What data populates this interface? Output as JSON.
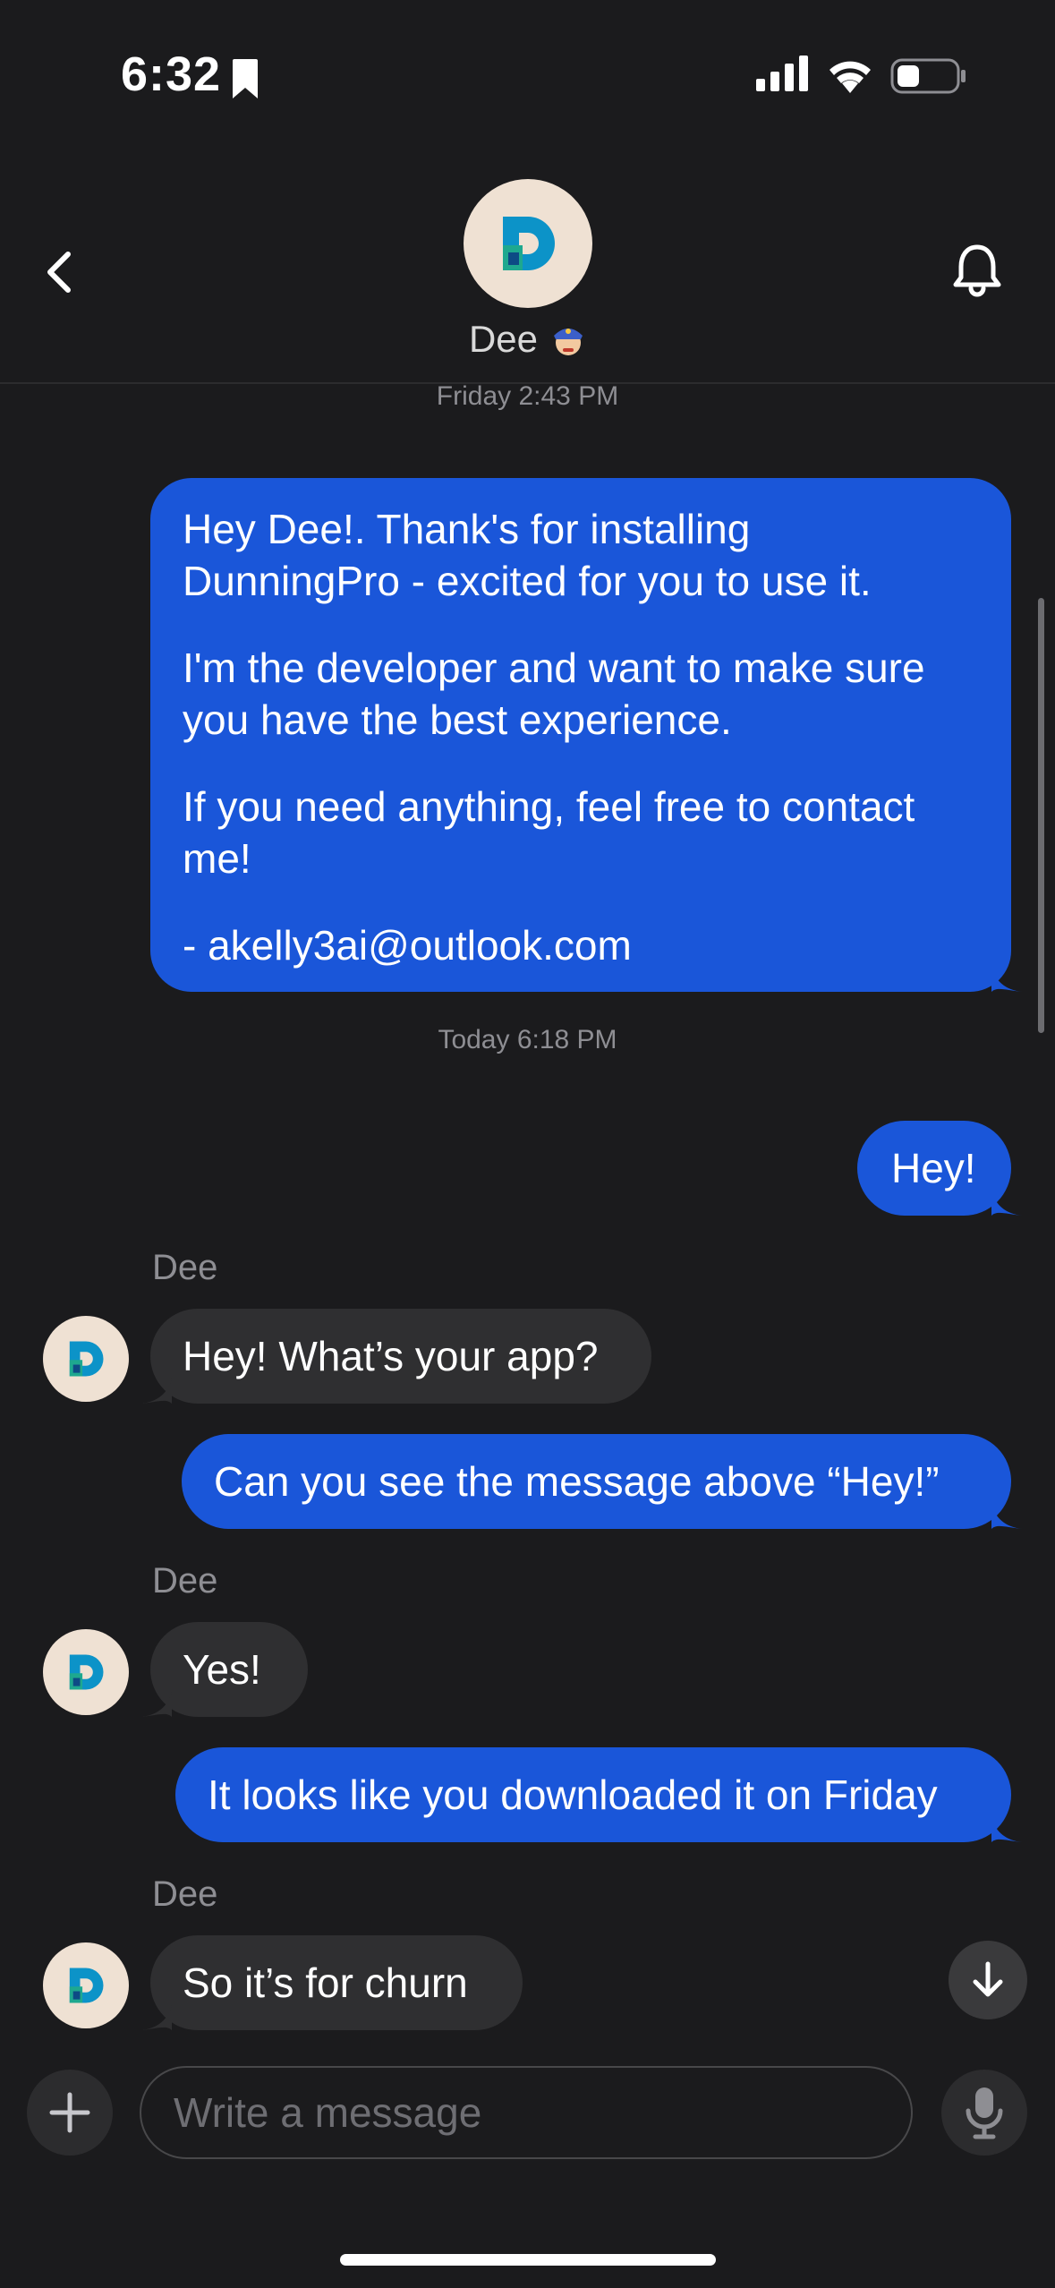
{
  "status_bar": {
    "time": "6:32"
  },
  "header": {
    "contact_name": "Dee",
    "back_label": "Back",
    "bell_label": "Notifications"
  },
  "timestamps": {
    "first": "Friday 2:43 PM",
    "second": "Today 6:18 PM"
  },
  "messages": [
    {
      "dir": "out",
      "paragraphs": [
        "Hey Dee!. Thank's for installing DunningPro - excited for you to use it.",
        "I'm the developer and want to make sure you have the best experience.",
        "If you need anything, feel free to contact me!",
        "- akelly3ai@outlook.com"
      ]
    },
    {
      "dir": "out",
      "text": "Hey!"
    },
    {
      "dir": "in",
      "sender": "Dee",
      "text": "Hey! What’s your app?"
    },
    {
      "dir": "out",
      "text": "Can you see the message above “Hey!”"
    },
    {
      "dir": "in",
      "sender": "Dee",
      "text": "Yes!"
    },
    {
      "dir": "out",
      "text": "It looks like you downloaded it on Friday"
    },
    {
      "dir": "in",
      "sender": "Dee",
      "text": "So it’s for churn"
    }
  ],
  "composer": {
    "placeholder": "Write a message"
  },
  "icons": {
    "back": "chevron-left-icon",
    "bell": "bell-icon",
    "plus": "plus-icon",
    "mic": "microphone-icon",
    "scroll_down": "arrow-down-icon",
    "avatar": "dunningpro-logo",
    "badge": "police-officer-emoji"
  },
  "colors": {
    "background": "#1b1b1d",
    "outgoing": "#1a56d9",
    "incoming": "#2f2f31",
    "muted": "#8e8e93"
  }
}
